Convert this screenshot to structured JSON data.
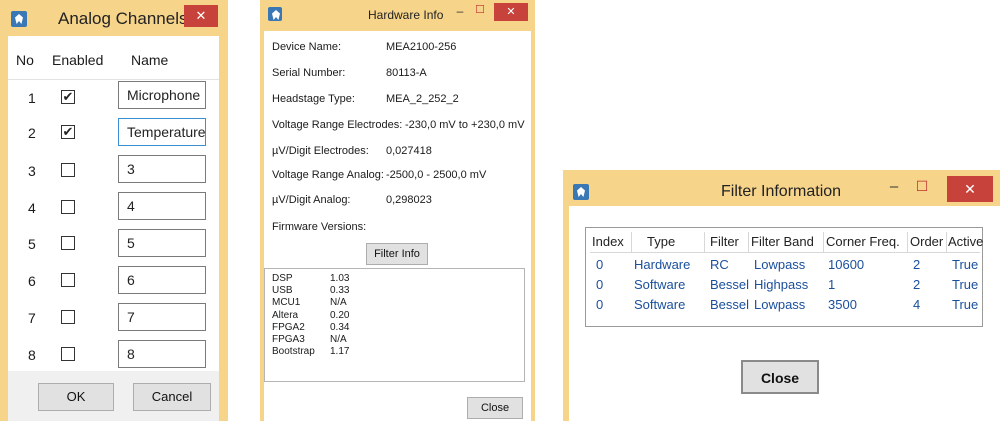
{
  "analog_channels": {
    "title": "Analog Channels",
    "close_glyph": "✕",
    "headers": {
      "no": "No",
      "enabled": "Enabled",
      "name": "Name"
    },
    "rows": [
      {
        "no": "1",
        "enabled": true,
        "name": "Microphone"
      },
      {
        "no": "2",
        "enabled": true,
        "name": "Temperature"
      },
      {
        "no": "3",
        "enabled": false,
        "name": "3"
      },
      {
        "no": "4",
        "enabled": false,
        "name": "4"
      },
      {
        "no": "5",
        "enabled": false,
        "name": "5"
      },
      {
        "no": "6",
        "enabled": false,
        "name": "6"
      },
      {
        "no": "7",
        "enabled": false,
        "name": "7"
      },
      {
        "no": "8",
        "enabled": false,
        "name": "8"
      }
    ],
    "ok_label": "OK",
    "cancel_label": "Cancel"
  },
  "hardware_info": {
    "title": "Hardware Info",
    "minimize_glyph": "–",
    "maximize_glyph": "☐",
    "close_glyph": "✕",
    "device_name": {
      "label": "Device Name:",
      "value": "MEA2100-256"
    },
    "serial_number": {
      "label": "Serial Number:",
      "value": "80113-A"
    },
    "headstage_type": {
      "label": "Headstage Type:",
      "value": "MEA_2_252_2"
    },
    "voltage_range_electrodes": {
      "label": "Voltage Range Electrodes:",
      "value": "-230,0 mV to +230,0 mV"
    },
    "uv_digit_electrodes": {
      "label": "µV/Digit Electrodes:",
      "value": "0,027418"
    },
    "voltage_range_analog": {
      "label": "Voltage Range Analog:",
      "value": "-2500,0 - 2500,0 mV"
    },
    "uv_digit_analog": {
      "label": "µV/Digit Analog:",
      "value": "0,298023"
    },
    "firmware_label": "Firmware Versions:",
    "filter_info_label": "Filter Info",
    "firmware": [
      {
        "name": "DSP",
        "version": "1.03"
      },
      {
        "name": "USB",
        "version": "0.33"
      },
      {
        "name": "MCU1",
        "version": "N/A"
      },
      {
        "name": "Altera",
        "version": "0.20"
      },
      {
        "name": "FPGA2",
        "version": "0.34"
      },
      {
        "name": "FPGA3",
        "version": "N/A"
      },
      {
        "name": "Bootstrap",
        "version": "1.17"
      }
    ],
    "close_label": "Close"
  },
  "filter_information": {
    "title": "Filter Information",
    "minimize_glyph": "–",
    "maximize_glyph": "☐",
    "close_glyph": "✕",
    "headers": {
      "index": "Index",
      "type": "Type",
      "filter": "Filter",
      "filter_band": "Filter Band",
      "corner_freq": "Corner Freq.",
      "order": "Order",
      "active": "Active"
    },
    "rows": [
      {
        "index": "0",
        "type": "Hardware",
        "filter": "RC",
        "filter_band": "Lowpass",
        "corner_freq": "10600",
        "order": "2",
        "active": "True"
      },
      {
        "index": "0",
        "type": "Software",
        "filter": "Bessel",
        "filter_band": "Highpass",
        "corner_freq": "1",
        "order": "2",
        "active": "True"
      },
      {
        "index": "0",
        "type": "Software",
        "filter": "Bessel",
        "filter_band": "Lowpass",
        "corner_freq": "3500",
        "order": "4",
        "active": "True"
      }
    ],
    "close_label": "Close"
  },
  "colors": {
    "window_border": "#f6d48a",
    "close_red": "#c7423a",
    "link_blue": "#1a4f9c"
  }
}
